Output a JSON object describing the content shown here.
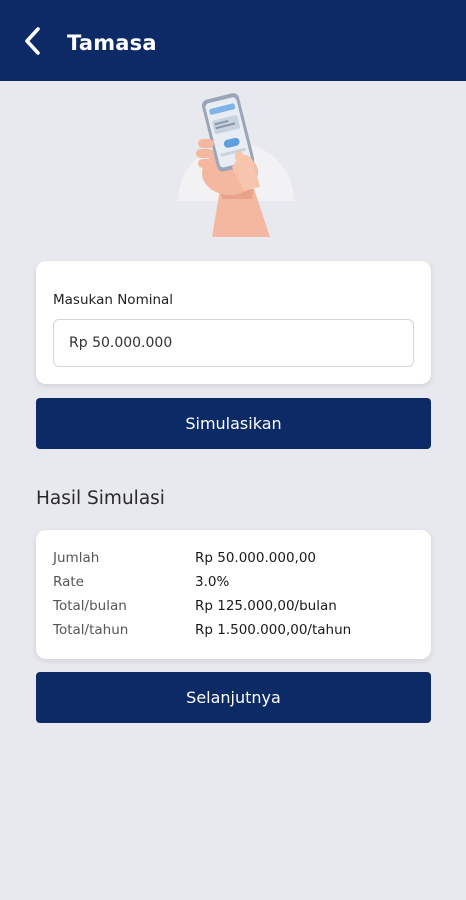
{
  "appbar": {
    "title": "Tamasa",
    "background": "#0c2a66",
    "back_icon": "chevron-left-icon"
  },
  "hero": {
    "icon": "hand-holding-phone-illustration"
  },
  "form": {
    "label": "Masukan Nominal",
    "value": "Rp 50.000.000",
    "button_label": "Simulasikan"
  },
  "result": {
    "title": "Hasil Simulasi",
    "rows": [
      {
        "key": "Jumlah",
        "value": "Rp 50.000.000,00"
      },
      {
        "key": "Rate",
        "value": "3.0%"
      },
      {
        "key": "Total/bulan",
        "value": "Rp 125.000,00/bulan"
      },
      {
        "key": "Total/tahun",
        "value": "Rp 1.500.000,00/tahun"
      }
    ]
  },
  "next_button_label": "Selanjutnya",
  "colors": {
    "primary": "#0c2a66",
    "page_bg": "#e8e9ee",
    "card_bg": "#ffffff"
  }
}
